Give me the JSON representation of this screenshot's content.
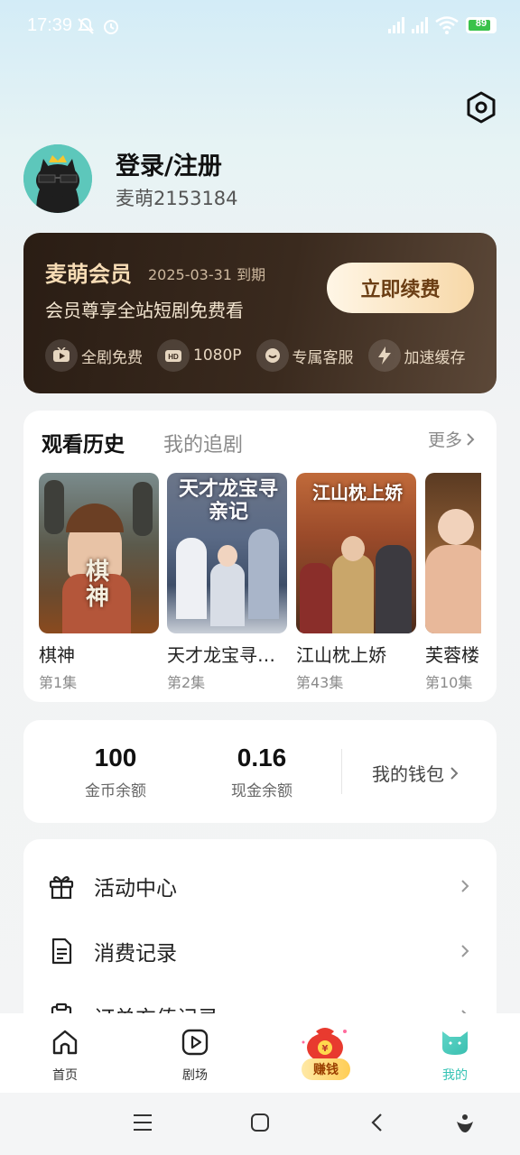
{
  "status_bar": {
    "time": "17:39",
    "battery": "89"
  },
  "profile": {
    "login_title": "登录/注册",
    "user_id": "麦萌2153184"
  },
  "vip": {
    "title": "麦萌会员",
    "expiry": "2025-03-31 到期",
    "description": "会员尊享全站短剧免费看",
    "renew_label": "立即续费",
    "perks": [
      {
        "icon": "tv-icon",
        "label": "全剧免费"
      },
      {
        "icon": "hd-icon",
        "label": "1080P"
      },
      {
        "icon": "support-icon",
        "label": "专属客服"
      },
      {
        "icon": "lightning-icon",
        "label": "加速缓存"
      }
    ]
  },
  "history": {
    "tabs": [
      "观看历史",
      "我的追剧"
    ],
    "more_label": "更多",
    "items": [
      {
        "title": "棋神",
        "episode": "第1集",
        "poster_text": "棋神"
      },
      {
        "title": "天才龙宝寻亲记",
        "episode": "第2集",
        "poster_text": "天才龙宝寻亲记"
      },
      {
        "title": "江山枕上娇",
        "episode": "第43集",
        "poster_text": "江山枕上娇"
      },
      {
        "title": "芙蓉楼",
        "episode": "第10集",
        "poster_text": ""
      }
    ]
  },
  "wallet": {
    "coins_value": "100",
    "coins_label": "金币余额",
    "cash_value": "0.16",
    "cash_label": "现金余额",
    "link_label": "我的钱包"
  },
  "menu": {
    "items": [
      {
        "icon": "gift-icon",
        "label": "活动中心"
      },
      {
        "icon": "document-icon",
        "label": "消费记录"
      },
      {
        "icon": "clipboard-icon",
        "label": "订单充值记录"
      }
    ]
  },
  "bottom_nav": {
    "items": [
      {
        "icon": "home-icon",
        "label": "首页"
      },
      {
        "icon": "play-icon",
        "label": "剧场"
      },
      {
        "icon": "money-bag-icon",
        "label": "赚钱"
      },
      {
        "icon": "cat-icon",
        "label": "我的"
      }
    ],
    "active_color": "#35c3b4"
  },
  "colors": {
    "vip_gold": "#f7dcb5",
    "accent": "#35c3b4"
  }
}
